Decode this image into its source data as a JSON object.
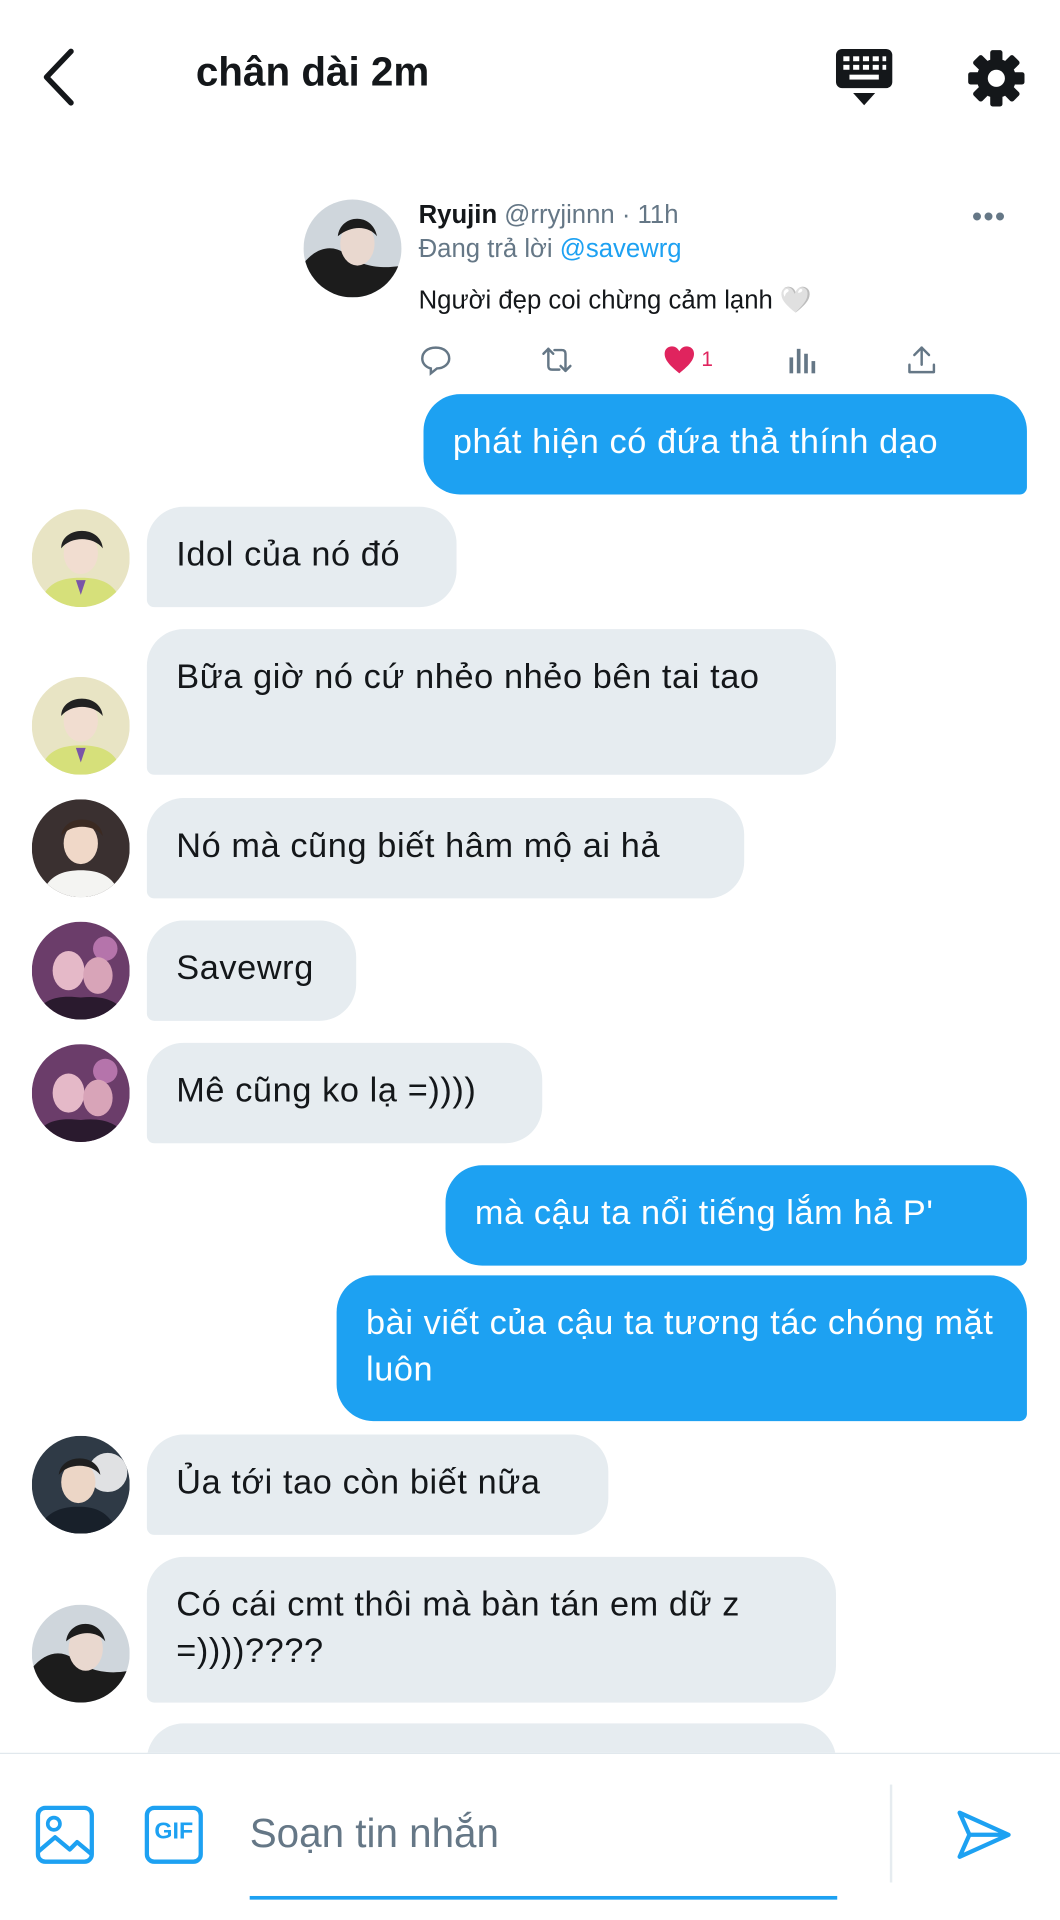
{
  "header": {
    "title": "chân dài 2m"
  },
  "tweet": {
    "name": "Ryujin",
    "handle_time": "@rryjinnn · 11h",
    "replying_prefix": "Đang trả lời",
    "replying_to": "@savewrg",
    "text": "Người đẹp coi chừng cảm lạnh 🤍",
    "like_count": "1"
  },
  "messages": [
    {
      "side": "sent",
      "text": "phát hiện có đứa thả thính dạo"
    },
    {
      "side": "received",
      "avatar": "avatar-a",
      "text": "Idol của nó đó"
    },
    {
      "side": "received",
      "avatar": "avatar-a",
      "text": "Bữa giờ nó cứ nhẻo nhẻo bên tai tao"
    },
    {
      "side": "received",
      "avatar": "avatar-b",
      "text": "Nó mà cũng biết hâm mộ ai hả"
    },
    {
      "side": "received",
      "avatar": "avatar-c",
      "text": "Savewrg"
    },
    {
      "side": "received",
      "avatar": "avatar-c",
      "text": "Mê cũng ko lạ =))))"
    },
    {
      "side": "sent",
      "text": "mà cậu ta nổi tiếng lắm hả P'"
    },
    {
      "side": "sent",
      "text": "bài viết của cậu ta tương tác chóng mặt luôn"
    },
    {
      "side": "received",
      "avatar": "avatar-d",
      "text": "Ủa tới tao còn biết nữa"
    },
    {
      "side": "received",
      "avatar": "avatar-e",
      "text": "Có cái cmt thôi mà bàn tán em dữ z =))))????"
    }
  ],
  "composer": {
    "placeholder": "Soạn tin nhắn",
    "gif_label": "GIF"
  },
  "colors": {
    "accent": "#1da1f2",
    "received_bubble": "#e6ecf0",
    "like": "#e0245e"
  },
  "icons": [
    "back-arrow-icon",
    "keyboard-icon",
    "gear-icon",
    "more-icon",
    "reply-icon",
    "retweet-icon",
    "heart-icon",
    "analytics-icon",
    "share-icon",
    "image-icon",
    "gif-icon",
    "send-icon"
  ]
}
